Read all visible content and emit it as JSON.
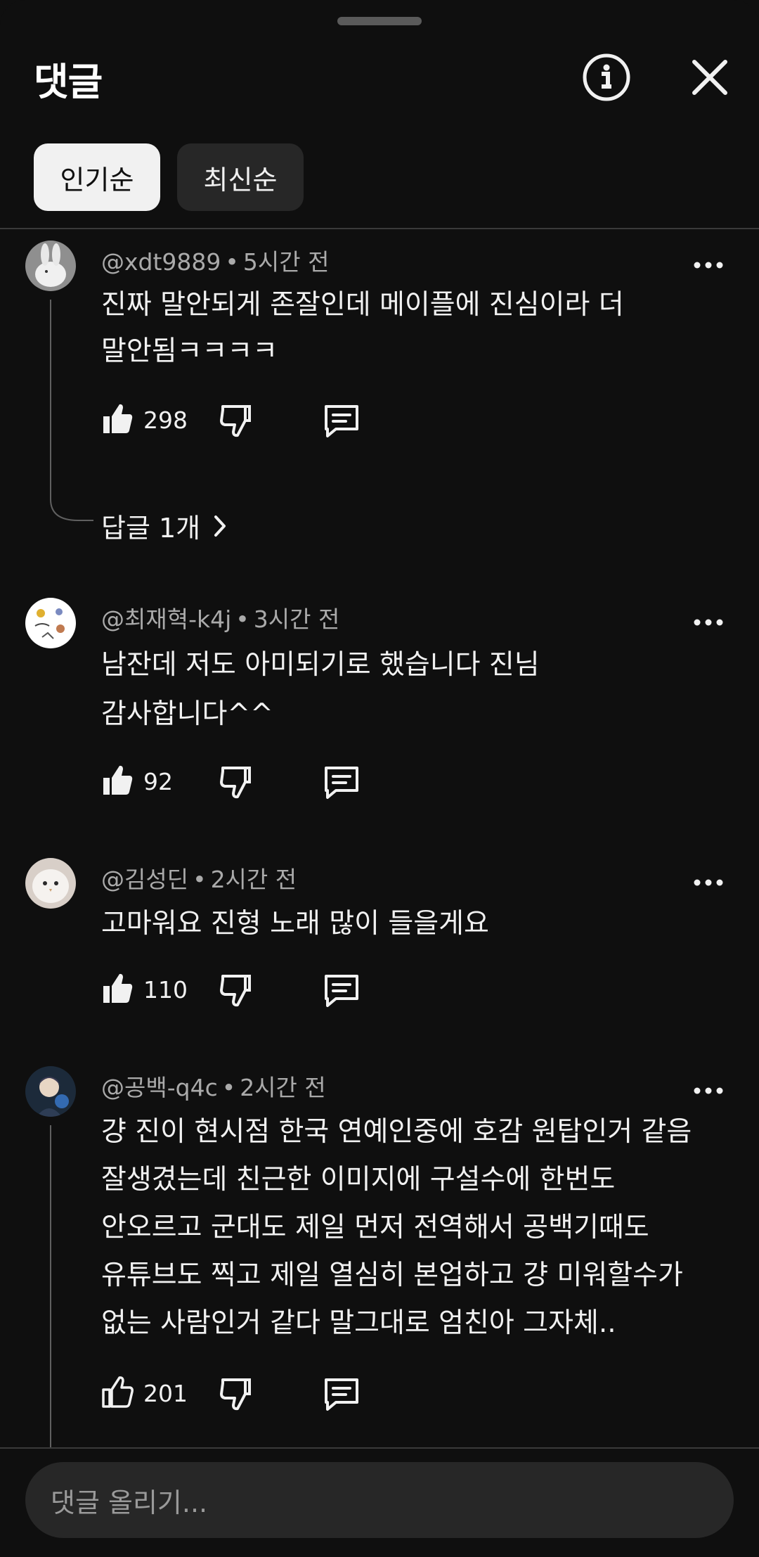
{
  "header": {
    "title": "댓글",
    "info_icon": "info-circle-icon",
    "close_icon": "close-icon"
  },
  "sort_chips": [
    {
      "label": "인기순",
      "selected": true
    },
    {
      "label": "최신순",
      "selected": false
    }
  ],
  "comments": [
    {
      "author": "@xdt9889",
      "time": "5시간 전",
      "lines": [
        "진짜 말안되게 존잘인데 메이플에 진심이라 더",
        "말안됨ㅋㅋㅋㅋ"
      ],
      "likes": "298",
      "reply_label": "답글 1개",
      "avatar_icon": "rabbit-avatar"
    },
    {
      "author": "@최재혁-k4j",
      "time": "3시간 전",
      "lines": [
        "남잔데 저도 아미되기로 했습니다 진님",
        "감사합니다^^"
      ],
      "likes": "92",
      "avatar_icon": "doodle-avatar"
    },
    {
      "author": "@김성딘",
      "time": "2시간 전",
      "lines": [
        "고마워요 진형 노래 많이 들을게요"
      ],
      "likes": "110",
      "avatar_icon": "white-bird-avatar"
    },
    {
      "author": "@공백-q4c",
      "time": "2시간 전",
      "lines": [
        "걍 진이 현시점 한국 연예인중에 호감 원탑인거 같음",
        "잘생겼는데 친근한 이미지에 구설수에 한번도",
        "안오르고 군대도 제일 먼저 전역해서 공백기때도",
        "유튜브도 찍고 제일 열심히 본업하고 걍 미워할수가",
        "없는 사람인거 같다 말그대로 엄친아 그자체.."
      ],
      "likes": "201",
      "avatar_icon": "anime-character-avatar"
    }
  ],
  "composer": {
    "placeholder": "댓글 올리기..."
  },
  "colors": {
    "background": "#0f0f0f",
    "chip_selected": "#f1f1f1",
    "chip_unselected": "#272727",
    "secondary_text": "#aaaaaa"
  }
}
